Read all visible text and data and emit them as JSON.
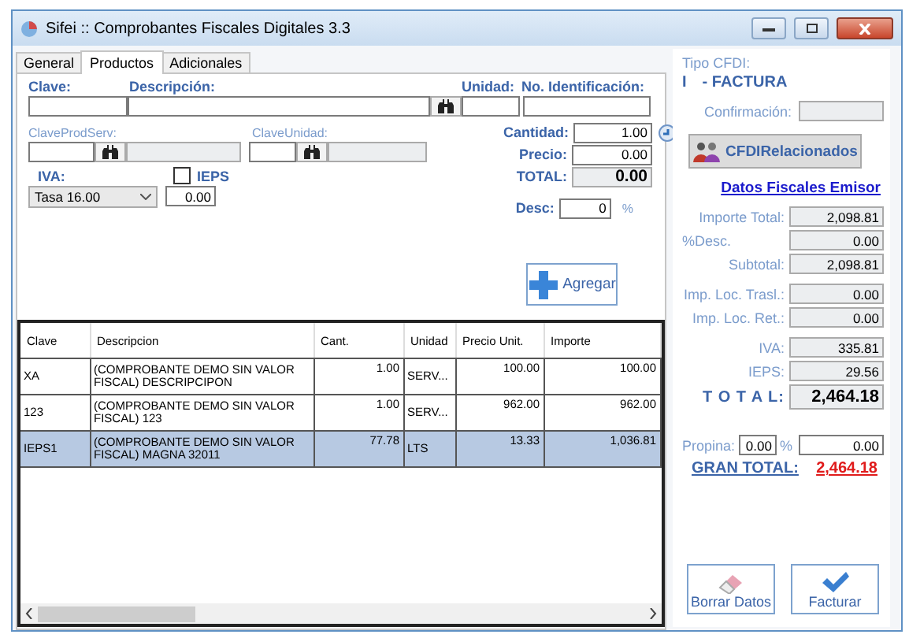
{
  "window": {
    "title": "Sifei :: Comprobantes Fiscales Digitales 3.3"
  },
  "tabs": [
    {
      "label": "General",
      "selected": false
    },
    {
      "label": "Productos",
      "selected": true
    },
    {
      "label": "Adicionales",
      "selected": false
    }
  ],
  "product_form": {
    "clave_label": "Clave:",
    "descripcion_label": "Descripción:",
    "unidad_label": "Unidad:",
    "no_identificacion_label": "No. Identificación:",
    "clave_prod_serv_label": "ClaveProdServ:",
    "clave_unidad_label": "ClaveUnidad:",
    "iva_label": "IVA:",
    "iva_select": "Tasa 16.00",
    "ieps": {
      "label": "IEPS",
      "checked": false,
      "value": "0.00"
    },
    "cantidad": {
      "label": "Cantidad:",
      "value": "1.00"
    },
    "precio": {
      "label": "Precio:",
      "value": "0.00"
    },
    "total": {
      "label": "TOTAL:",
      "value": "0.00"
    },
    "desc": {
      "label": "Desc:",
      "value": "0",
      "unit": "%"
    },
    "add_button": "Agregar"
  },
  "table": {
    "columns": [
      "Clave",
      "Descripcion",
      "Cant.",
      "Unidad",
      "Precio Unit.",
      "Importe"
    ],
    "rows": [
      {
        "cells": [
          "XA",
          "(COMPROBANTE DEMO SIN VALOR FISCAL) DESCRIPCIPON",
          "1.00",
          "SERV...",
          "100.00",
          "100.00"
        ],
        "selected": false
      },
      {
        "cells": [
          "123",
          "(COMPROBANTE DEMO SIN VALOR FISCAL) 123",
          "1.00",
          "SERV...",
          "962.00",
          "962.00"
        ],
        "selected": false
      },
      {
        "cells": [
          "IEPS1",
          "(COMPROBANTE DEMO SIN VALOR FISCAL) MAGNA 32011",
          "77.78",
          "LTS",
          "13.33",
          "1,036.81"
        ],
        "selected": true
      }
    ]
  },
  "summary": {
    "tipo_cfdi_label": "Tipo CFDI:",
    "tipo_code": "I",
    "tipo_name": "- FACTURA",
    "confirmacion_label": "Confirmación:",
    "related_button": "CFDIRelacionados",
    "issuer_link": "Datos Fiscales Emisor",
    "groups": [
      [
        {
          "label": "Importe Total:",
          "value": "2,098.81",
          "kind": "amount"
        },
        {
          "label": "%Desc.",
          "value": "0.00",
          "kind": "leftlabel"
        },
        {
          "label": "Subtotal:",
          "value": "2,098.81",
          "kind": "amount"
        }
      ],
      [
        {
          "label": "Imp. Loc. Trasl.:",
          "value": "0.00",
          "kind": "amount"
        },
        {
          "label": "Imp. Loc. Ret.:",
          "value": "0.00",
          "kind": "amount"
        }
      ],
      [
        {
          "label": "IVA:",
          "value": "335.81",
          "kind": "amount"
        },
        {
          "label": "IEPS:",
          "value": "29.56",
          "kind": "amount"
        },
        {
          "label": "T O T A L:",
          "value": "2,464.18",
          "kind": "total"
        }
      ]
    ],
    "propina": {
      "label": "Propina:",
      "percent": "0.00",
      "unit": "%",
      "value": "0.00"
    },
    "grand_total": {
      "label": "GRAN TOTAL:",
      "value": "2,464.18"
    }
  },
  "buttons": [
    {
      "label": "Borrar Datos",
      "kind": "clear"
    },
    {
      "label": "Facturar",
      "kind": "invoice"
    }
  ]
}
